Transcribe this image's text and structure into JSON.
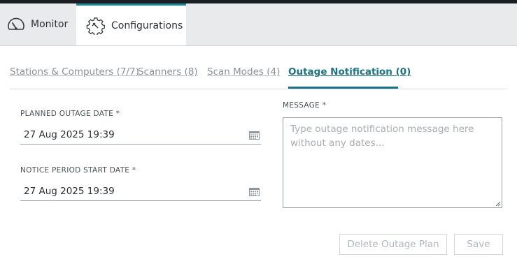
{
  "nav": {
    "tabs": [
      {
        "label": "Monitor",
        "icon": "gauge-icon",
        "active": false
      },
      {
        "label": "Configurations",
        "icon": "gear-wrench-icon",
        "active": true
      }
    ]
  },
  "subtabs": [
    {
      "label": "Stations & Computers (7/7)",
      "active": false
    },
    {
      "label": "Scanners (8)",
      "active": false
    },
    {
      "label": "Scan Modes (4)",
      "active": false
    },
    {
      "label": "Outage Notification (0)",
      "active": true
    }
  ],
  "form": {
    "planned_outage": {
      "label": "PLANNED OUTAGE DATE *",
      "value": "27 Aug 2025 19:39"
    },
    "notice_period": {
      "label": "NOTICE PERIOD START DATE *",
      "value": "27 Aug 2025 19:39"
    },
    "message": {
      "label": "MESSAGE *",
      "value": "",
      "placeholder": "Type outage notification message here without any dates..."
    }
  },
  "buttons": {
    "delete_label": "Delete Outage Plan",
    "save_label": "Save",
    "enabled": false
  },
  "colors": {
    "accent": "#1a7384",
    "topbar": "#1b1e22",
    "header_bg": "#e9eaec"
  }
}
